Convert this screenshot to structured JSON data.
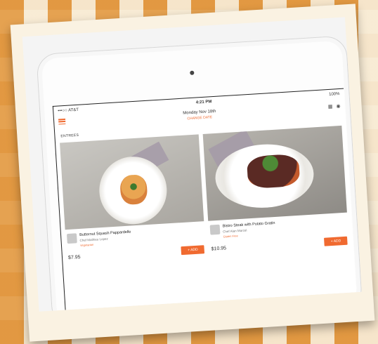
{
  "status": {
    "carrier": "•••○○ AT&T",
    "time": "4:21 PM",
    "battery": "100%"
  },
  "header": {
    "date": "Monday Nov 18th",
    "subtitle": "CHANGE DATE"
  },
  "section_label": "ENTREES",
  "items": [
    {
      "title": "Butternut Squash Pappardelle",
      "chef": "Chef Mathieu Lopez",
      "extra": "Vegetarian",
      "price": "$7.95",
      "add_label": "+ ADD"
    },
    {
      "title": "Bistro Steak with Potato Gratin",
      "chef": "Chef Alan Marcel",
      "extra": "Gluten Free",
      "price": "$10.95",
      "add_label": "+ ADD"
    }
  ]
}
